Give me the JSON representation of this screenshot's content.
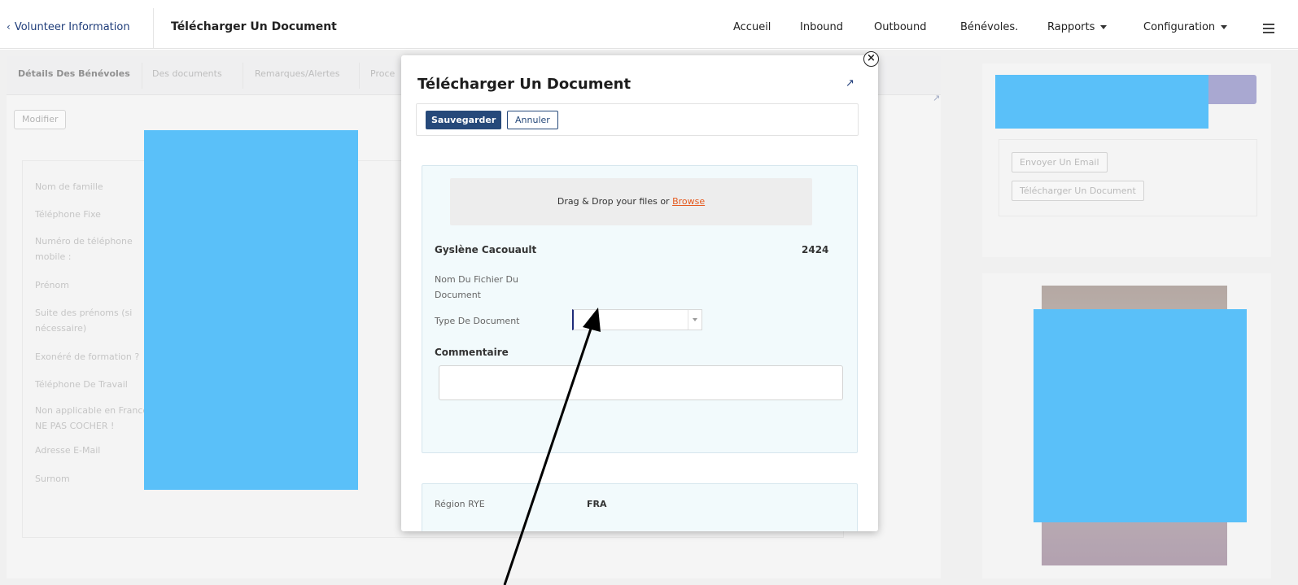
{
  "header": {
    "back_label": "Volunteer Information",
    "page_title": "Télécharger Un Document",
    "nav": [
      {
        "label": "Accueil",
        "dropdown": false
      },
      {
        "label": "Inbound",
        "dropdown": false
      },
      {
        "label": "Outbound",
        "dropdown": false
      },
      {
        "label": "Bénévoles.",
        "dropdown": false
      },
      {
        "label": "Rapports",
        "dropdown": true
      },
      {
        "label": "Configuration",
        "dropdown": true
      }
    ]
  },
  "background": {
    "tabs": [
      "Détails Des Bénévoles",
      "Des documents",
      "Remarques/Alertes",
      "Proce"
    ],
    "modify_label": "Modifier",
    "fields": [
      "Nom de famille",
      "Téléphone Fixe",
      "Numéro de téléphone mobile :",
      "Prénom",
      "Suite des prénoms (si nécessaire)",
      "Exonéré de formation ?",
      "Téléphone De Travail",
      "Non applicable en France NE PAS COCHER !",
      "Adresse E-Mail",
      "Surnom"
    ],
    "actions": [
      "Envoyer Un Email",
      "Télécharger Un Document"
    ]
  },
  "modal": {
    "title": "Télécharger Un Document",
    "save_label": "Sauvegarder",
    "cancel_label": "Annuler",
    "dropzone_text": "Drag & Drop your files or ",
    "browse_label": "Browse",
    "volunteer_name": "Gyslène Cacouault",
    "volunteer_id": "2424",
    "file_name_label": "Nom Du Fichier Du Document",
    "doc_type_label": "Type De Document",
    "doc_type_value": "",
    "comment_label": "Commentaire",
    "region_label": "Région RYE",
    "region_value": "FRA"
  },
  "colors": {
    "primary": "#26497a",
    "redaction": "#039ff6",
    "accent_bar": "#7b7ab8",
    "link_orange": "#e55a1f"
  }
}
